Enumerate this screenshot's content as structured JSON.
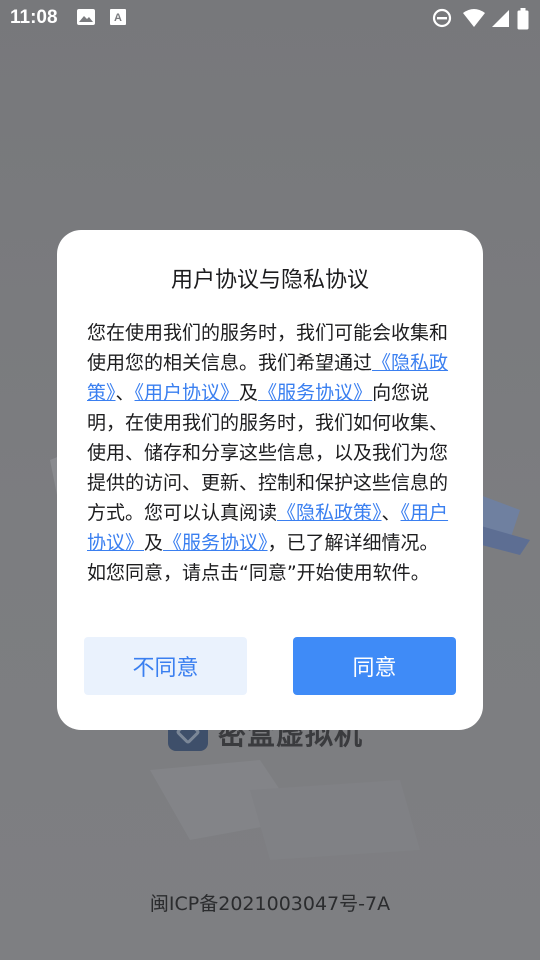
{
  "status_bar": {
    "time": "11:08",
    "icons": [
      "image-icon",
      "text-notification-icon",
      "do-not-disturb-icon",
      "wifi-icon",
      "cell-signal-icon",
      "battery-icon"
    ]
  },
  "dialog": {
    "title": "用户协议与隐私协议",
    "body": {
      "t1": "您在使用我们的服务时，我们可能会收集和使用您的相关信息。我们希望通过",
      "link_privacy": "《隐私政策》",
      "sep1": "、",
      "link_user": "《用户协议》",
      "and1": "及",
      "link_service": "《服务协议》",
      "t2": "向您说明，在使用我们的服务时，我们如何收集、使用、储存和分享这些信息，以及我们为您提供的访问、更新、控制和保护这些信息的方式。您可以认真阅读",
      "link_privacy2": "《隐私政策》",
      "sep2": "、",
      "link_user2": "《用户协议》",
      "and2": "及",
      "link_service2": "《服务协议》",
      "t3": "，已了解详细情况。如您同意，请点击“同意”开始使用软件。"
    },
    "disagree_label": "不同意",
    "agree_label": "同意"
  },
  "background": {
    "app_name": "密盒虚拟机",
    "icp": "闽ICP备2021003047号-7A"
  },
  "colors": {
    "link": "#3a7ff0",
    "agree_bg": "#3f8bf7",
    "disagree_bg": "#eaf2fd"
  }
}
